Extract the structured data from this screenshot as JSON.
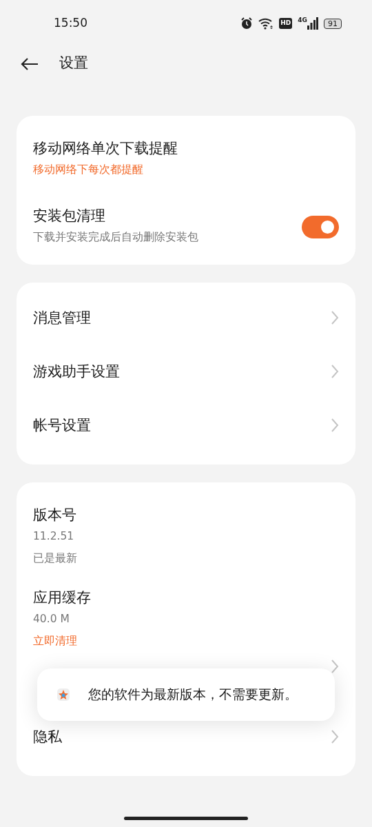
{
  "status_bar": {
    "time": "15:50",
    "hd": "HD",
    "network": "4G",
    "battery": "91"
  },
  "header": {
    "title": "设置"
  },
  "cards": [
    {
      "rows": [
        {
          "kind": "detail",
          "title": "移动网络单次下载提醒",
          "lines": [
            {
              "text": "移动网络下每次都提醒",
              "accent": true
            }
          ]
        },
        {
          "kind": "toggle",
          "title": "安装包清理",
          "lines": [
            {
              "text": "下载并安装完成后自动删除安装包",
              "accent": false
            }
          ],
          "on": true
        }
      ]
    },
    {
      "rows": [
        {
          "kind": "link",
          "title": "消息管理"
        },
        {
          "kind": "link",
          "title": "游戏助手设置"
        },
        {
          "kind": "link",
          "title": "帐号设置"
        }
      ]
    },
    {
      "rows": [
        {
          "kind": "detail",
          "title": "版本号",
          "lines": [
            {
              "text": "11.2.51",
              "accent": false
            },
            {
              "text": "已是最新",
              "accent": false
            }
          ]
        },
        {
          "kind": "detail",
          "title": "应用缓存",
          "lines": [
            {
              "text": "40.0 M",
              "accent": false
            },
            {
              "text": "立即清理",
              "accent": true
            }
          ]
        },
        {
          "kind": "link"
        },
        {
          "kind": "link",
          "title": "隐私"
        }
      ]
    }
  ],
  "toast": {
    "message": "您的软件为最新版本，不需要更新。"
  }
}
